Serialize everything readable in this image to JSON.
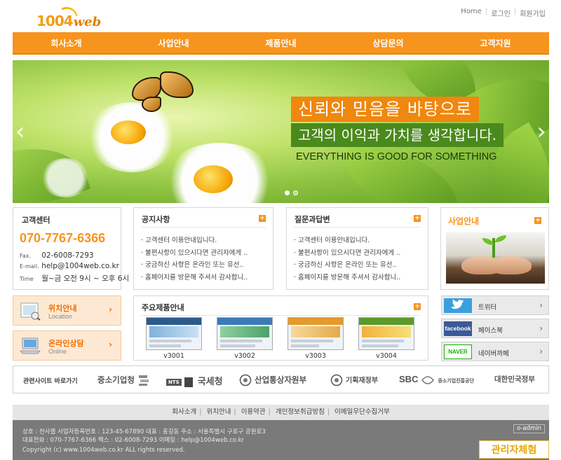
{
  "header": {
    "logo_num": "1004",
    "logo_web": "web",
    "top_links": [
      "Home",
      "로그인",
      "회원가입"
    ]
  },
  "nav": [
    "회사소개",
    "사업안내",
    "제품안내",
    "상담문의",
    "고객지원"
  ],
  "hero": {
    "headline": "신뢰와 믿음을 바탕으로",
    "subheadline": "고객의 이익과 가치를 생각합니다.",
    "tagline": "EVERYTHING IS GOOD FOR SOMETHING",
    "prev_arrow": "‹",
    "next_arrow": "›"
  },
  "customer_center": {
    "title": "고객센터",
    "phone": "070-7767-6366",
    "fax_label": "Fax.",
    "fax": "02-6008-7293",
    "email_label": "E-mail.",
    "email": "help@1004web.co.kr",
    "time_label": "Time",
    "time": "월~금 오전 9시 ~ 오후 6시"
  },
  "notice": {
    "title": "공지사항",
    "plus": "+",
    "items": [
      "고객센터 이용안내입니다.",
      "불편사항이 있으시다면 관리자에게 ..",
      "궁금하신 사항은 온라인 또는 유선..",
      "홈페이지를 방문해 주셔서 감사합니.."
    ]
  },
  "qna": {
    "title": "질문과답변",
    "plus": "+",
    "items": [
      "고객센터 이용안내입니다.",
      "불편사항이 있으시다면 관리자에게 ..",
      "궁금하신 사항은 온라인 또는 유선..",
      "홈페이지를 방문해 주셔서 감사합니.."
    ]
  },
  "business": {
    "title": "사업안내",
    "plus": "+"
  },
  "location": {
    "title": "위치안내",
    "sub": "Location",
    "arrow": "›"
  },
  "consult": {
    "title": "온라인상담",
    "sub": "Online",
    "arrow": "›"
  },
  "products": {
    "title": "주요제품안내",
    "plus": "+",
    "items": [
      "v3001",
      "v3002",
      "v3003",
      "v3004"
    ]
  },
  "social": [
    {
      "logo": "twitter",
      "label": "트위터",
      "arrow": "›",
      "color": "#3aa0dd"
    },
    {
      "logo": "facebook",
      "label": "페이스북",
      "arrow": "›",
      "color": "#3b5998"
    },
    {
      "logo": "NAVER",
      "label": "네이버까페",
      "arrow": "›",
      "color": "#19b400"
    }
  ],
  "related": {
    "label": "관련사이트 바로가기",
    "sites": [
      "중소기업청",
      "국세청",
      "산업통상자원부",
      "기획재정부",
      "SBC",
      "중소기업진흥공단",
      "대한민국정부"
    ],
    "nts": "NTS"
  },
  "footer": {
    "links": [
      "회사소개",
      "위치안내",
      "이용약관",
      "개인정보취급방침",
      "이메일무단수집거부"
    ],
    "line1": "상호 : 천사웹  사업자등록번호 : 123-45-67890  대표 : 홍길동  주소 : 서울특별시 구로구 공원로3",
    "line2": "대표전화 : 070-7767-6366  팩스 : 02-6008-7293  이메일 : help@1004web.co.kr",
    "copyright": "Copyright (c) www.1004web.co.kr ALL rights reserved.",
    "admin": "o-admin",
    "experience": "관리자체험"
  }
}
